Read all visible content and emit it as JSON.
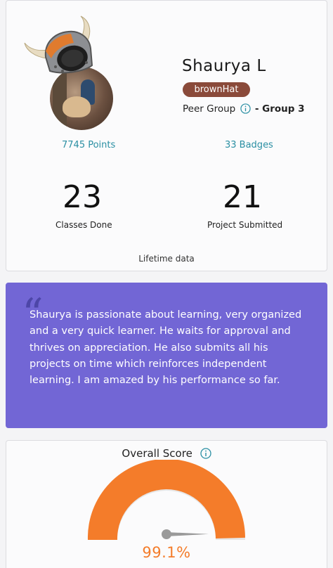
{
  "profile": {
    "name": "Shaurya L",
    "hat_badge": "brownHat",
    "peer_group_label": "Peer Group",
    "peer_group_value": "- Group 3",
    "points": "7745 Points",
    "badges": "33 Badges",
    "classes_done_value": "23",
    "classes_done_label": "Classes Done",
    "projects_value": "21",
    "projects_label": "Project Submitted",
    "lifetime_label": "Lifetime data",
    "avatar_icon": "viking-helmet-avatar",
    "hat_color": "#8a4a3a"
  },
  "testimonial": {
    "quote_mark": "“",
    "text": "Shaurya is passionate about learning, very organized and a very quick learner. He waits for approval and thrives on appreciation. He also submits all his projects on time which reinforces independent learning. I am amazed by his performance so far.",
    "background_color": "#7266d5"
  },
  "score": {
    "title": "Overall Score",
    "value_label": "99.1%",
    "value": 99.1,
    "gauge_color": "#f47c2a",
    "info_icon": "info-icon"
  },
  "colors": {
    "accent_teal": "#2a8fa3",
    "accent_orange": "#f47c2a"
  }
}
